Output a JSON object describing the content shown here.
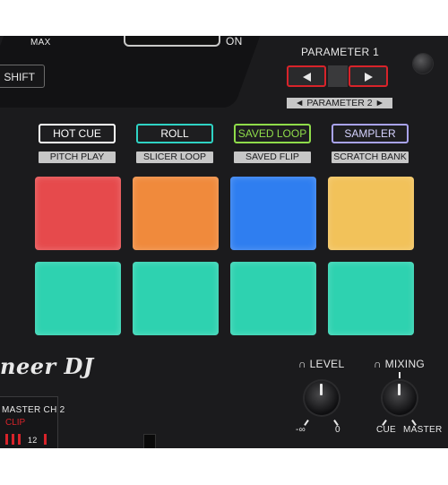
{
  "top": {
    "max_label": "MAX",
    "on_label": "ON",
    "shift_label": "SHIFT",
    "parameter1_label": "PARAMETER 1",
    "parameter2_label": "◄ PARAMETER 2 ►"
  },
  "modes": [
    {
      "label": "HOT CUE",
      "sub": "PITCH PLAY",
      "color": "#ffffff"
    },
    {
      "label": "ROLL",
      "sub": "SLICER LOOP",
      "color": "#2fd3c4"
    },
    {
      "label": "SAVED LOOP",
      "sub": "SAVED FLIP",
      "color": "#8fdc4a"
    },
    {
      "label": "SAMPLER",
      "sub": "SCRATCH BANK",
      "color": "#a9a3f0"
    }
  ],
  "pads": {
    "row1": [
      "#e64a4c",
      "#f08a3c",
      "#2f7ef0",
      "#f2c25a"
    ],
    "row2": [
      "#2ed2b0",
      "#2ed2b0",
      "#2ed2b0",
      "#2ed2b0"
    ]
  },
  "brand": {
    "logo_text": "neer DJ"
  },
  "level": {
    "label": "LEVEL",
    "min": "-∞",
    "max": "0"
  },
  "mixing": {
    "label": "MIXING",
    "left": "CUE",
    "right": "MASTER"
  },
  "meter": {
    "label": "MASTER  CH 2",
    "clip": "CLIP",
    "value": "12"
  }
}
